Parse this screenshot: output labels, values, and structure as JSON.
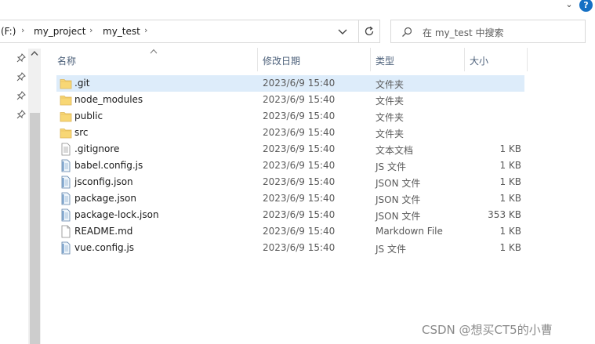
{
  "window": {
    "expand_glyph": "⌄",
    "help_glyph": "?"
  },
  "address": {
    "crumbs": [
      "(F:)",
      "my_project",
      "my_test"
    ],
    "separator": "›"
  },
  "search": {
    "placeholder": "在 my_test 中搜索"
  },
  "columns": {
    "name": "名称",
    "date": "修改日期",
    "type": "类型",
    "size": "大小"
  },
  "files": [
    {
      "name": ".git",
      "date": "2023/6/9 15:40",
      "type": "文件夹",
      "size": "",
      "icon": "folder-icon",
      "selected": true
    },
    {
      "name": "node_modules",
      "date": "2023/6/9 15:40",
      "type": "文件夹",
      "size": "",
      "icon": "folder-icon",
      "selected": false
    },
    {
      "name": "public",
      "date": "2023/6/9 15:40",
      "type": "文件夹",
      "size": "",
      "icon": "folder-icon",
      "selected": false
    },
    {
      "name": "src",
      "date": "2023/6/9 15:40",
      "type": "文件夹",
      "size": "",
      "icon": "folder-icon",
      "selected": false
    },
    {
      "name": ".gitignore",
      "date": "2023/6/9 15:40",
      "type": "文本文档",
      "size": "1 KB",
      "icon": "text-file-icon",
      "selected": false
    },
    {
      "name": "babel.config.js",
      "date": "2023/6/9 15:40",
      "type": "JS 文件",
      "size": "1 KB",
      "icon": "script-file-icon",
      "selected": false
    },
    {
      "name": "jsconfig.json",
      "date": "2023/6/9 15:40",
      "type": "JSON 文件",
      "size": "1 KB",
      "icon": "script-file-icon",
      "selected": false
    },
    {
      "name": "package.json",
      "date": "2023/6/9 15:40",
      "type": "JSON 文件",
      "size": "1 KB",
      "icon": "script-file-icon",
      "selected": false
    },
    {
      "name": "package-lock.json",
      "date": "2023/6/9 15:40",
      "type": "JSON 文件",
      "size": "353 KB",
      "icon": "script-file-icon",
      "selected": false
    },
    {
      "name": "README.md",
      "date": "2023/6/9 15:40",
      "type": "Markdown File",
      "size": "1 KB",
      "icon": "blank-file-icon",
      "selected": false
    },
    {
      "name": "vue.config.js",
      "date": "2023/6/9 15:40",
      "type": "JS 文件",
      "size": "1 KB",
      "icon": "script-file-icon",
      "selected": false
    }
  ],
  "nav": {
    "pin_glyph": "📌",
    "scroll_up_glyph": "▲"
  },
  "watermark": "CSDN @想买CT5的小曹",
  "colors": {
    "selection": "#ddecfa",
    "folder": "#f8d775",
    "accent": "#1570c4"
  }
}
